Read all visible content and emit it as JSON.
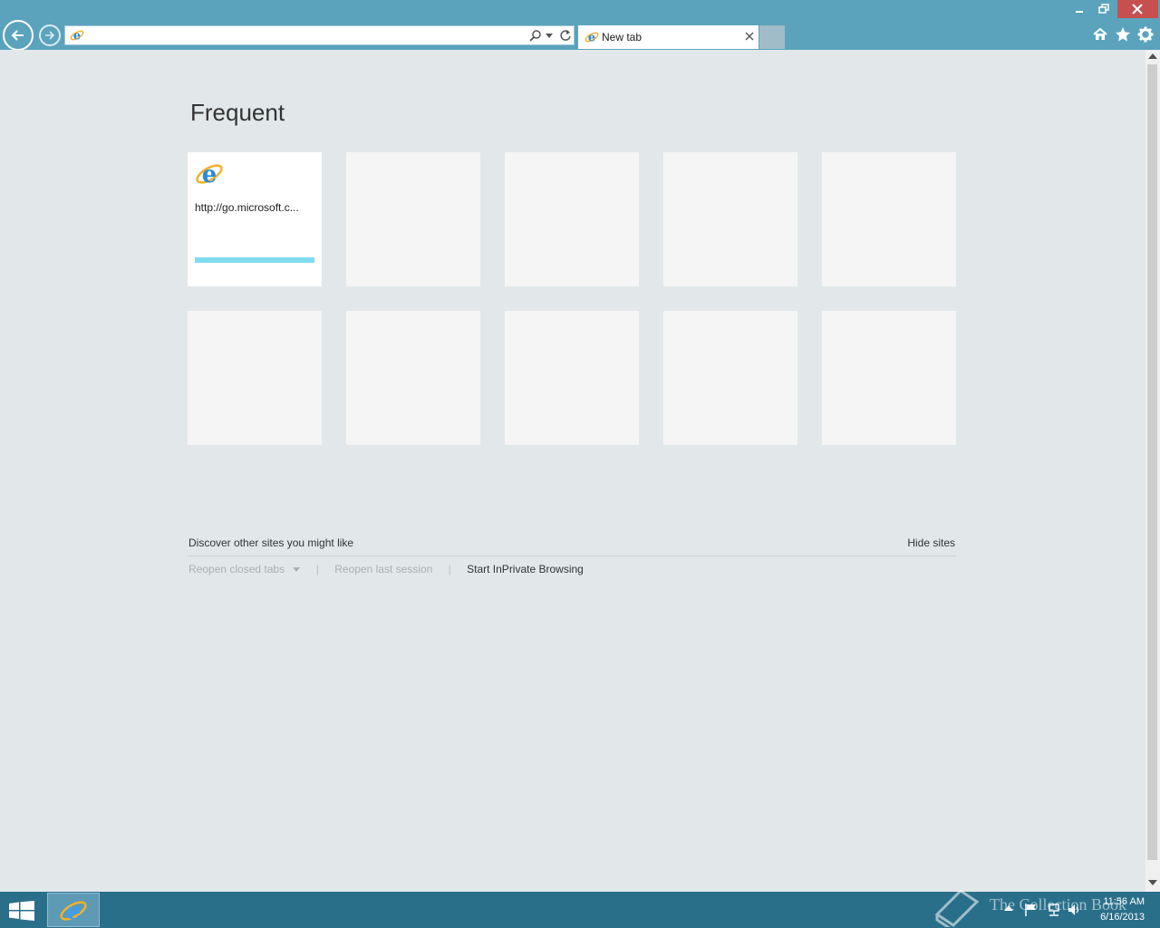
{
  "browser": {
    "address": {
      "value": "",
      "placeholder": ""
    },
    "tab": {
      "title": "New tab"
    },
    "buttons": {
      "back": "back",
      "forward": "forward",
      "home": "home",
      "favorites": "favorites",
      "tools": "tools"
    }
  },
  "content": {
    "heading": "Frequent",
    "tiles": [
      {
        "url": "http://go.microsoft.c...",
        "icon": "internet-explorer-icon",
        "usage_fraction": 1.0
      },
      {
        "url": ""
      },
      {
        "url": ""
      },
      {
        "url": ""
      },
      {
        "url": ""
      },
      {
        "url": ""
      },
      {
        "url": ""
      },
      {
        "url": ""
      },
      {
        "url": ""
      },
      {
        "url": ""
      }
    ],
    "discover_text": "Discover other sites you might like",
    "hide_sites": "Hide sites",
    "actions": {
      "reopen_closed_tabs": "Reopen closed tabs",
      "reopen_last_session": "Reopen last session",
      "inprivate": "Start InPrivate Browsing",
      "separator": "|"
    }
  },
  "taskbar": {
    "watermark": "The Collection Book",
    "time": "11:56 AM",
    "date": "6/16/2013"
  },
  "colors": {
    "chrome": "#5ba3bd",
    "taskbar": "#2a6f8a",
    "close_button": "#c74f4f",
    "content_bg": "#e2e8e9",
    "tile_usage_bar": "#7fdcef"
  }
}
